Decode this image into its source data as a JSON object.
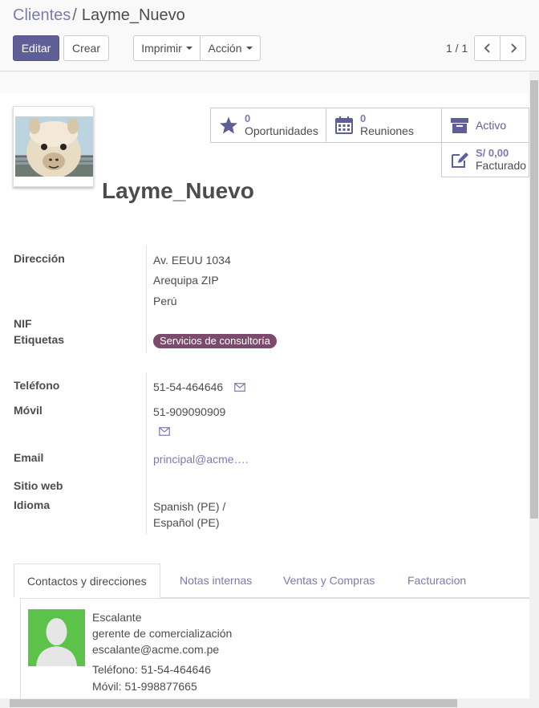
{
  "breadcrumb": {
    "parent": "Clientes",
    "separator": "/",
    "current": "Layme_Nuevo"
  },
  "toolbar": {
    "edit_label": "Editar",
    "create_label": "Crear",
    "print_label": "Imprimir",
    "action_label": "Acción"
  },
  "pager": {
    "value": "1 / 1"
  },
  "stats": {
    "opportunities": {
      "count": "0",
      "label": "Oportunidades"
    },
    "meetings": {
      "count": "0",
      "label": "Reuniones"
    },
    "active": {
      "label": "Activo"
    },
    "invoiced": {
      "amount": "S/ 0,00",
      "label": "Facturado"
    }
  },
  "partner": {
    "name": "Layme_Nuevo"
  },
  "fields": {
    "address": {
      "label": "Dirección",
      "line1": "Av. EEUU 1034",
      "line2": "Arequipa ZIP",
      "line3": "Perú"
    },
    "vat": {
      "label": "NIF"
    },
    "tags": {
      "label": "Etiquetas",
      "value": "Servicios de consultoría"
    },
    "phone": {
      "label": "Teléfono",
      "value": "51-54-464646"
    },
    "mobile": {
      "label": "Móvil",
      "value": "51-909090909"
    },
    "email": {
      "label": "Email",
      "value": "principal@acme…."
    },
    "website": {
      "label": "Sitio web"
    },
    "language": {
      "label": "Idioma",
      "line1": "Spanish (PE) /",
      "line2": "Español (PE)"
    }
  },
  "tabs": [
    {
      "label": "Contactos y direcciones"
    },
    {
      "label": "Notas internas"
    },
    {
      "label": "Ventas y Compras"
    },
    {
      "label": "Facturacion"
    }
  ],
  "contact": {
    "name": "Escalante",
    "role": "gerente de comercialización",
    "email": "escalante@acme.com.pe",
    "phone": "Teléfono: 51-54-464646",
    "mobile": "Móvil: 51-998877665"
  },
  "colors": {
    "brand": "#7c7bad",
    "primary_button": "#5f5e97",
    "tag": "#7c4a6c",
    "contact_avatar_bg": "#5dc24a"
  },
  "icons": [
    "star-icon",
    "calendar-icon",
    "archive-icon",
    "edit-icon",
    "envelope-icon",
    "chevron-left-icon",
    "chevron-right-icon",
    "caret-down-icon"
  ]
}
